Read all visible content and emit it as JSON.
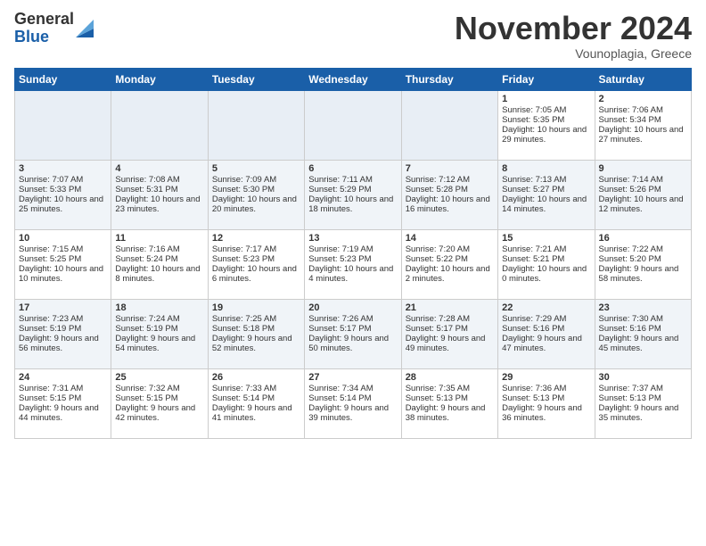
{
  "header": {
    "logo_line1": "General",
    "logo_line2": "Blue",
    "month_title": "November 2024",
    "location": "Vounoplagia, Greece"
  },
  "weekdays": [
    "Sunday",
    "Monday",
    "Tuesday",
    "Wednesday",
    "Thursday",
    "Friday",
    "Saturday"
  ],
  "weeks": [
    [
      {
        "day": "",
        "empty": true
      },
      {
        "day": "",
        "empty": true
      },
      {
        "day": "",
        "empty": true
      },
      {
        "day": "",
        "empty": true
      },
      {
        "day": "",
        "empty": true
      },
      {
        "day": "1",
        "sunrise": "7:05 AM",
        "sunset": "5:35 PM",
        "daylight": "10 hours and 29 minutes."
      },
      {
        "day": "2",
        "sunrise": "7:06 AM",
        "sunset": "5:34 PM",
        "daylight": "10 hours and 27 minutes."
      }
    ],
    [
      {
        "day": "3",
        "sunrise": "7:07 AM",
        "sunset": "5:33 PM",
        "daylight": "10 hours and 25 minutes."
      },
      {
        "day": "4",
        "sunrise": "7:08 AM",
        "sunset": "5:31 PM",
        "daylight": "10 hours and 23 minutes."
      },
      {
        "day": "5",
        "sunrise": "7:09 AM",
        "sunset": "5:30 PM",
        "daylight": "10 hours and 20 minutes."
      },
      {
        "day": "6",
        "sunrise": "7:11 AM",
        "sunset": "5:29 PM",
        "daylight": "10 hours and 18 minutes."
      },
      {
        "day": "7",
        "sunrise": "7:12 AM",
        "sunset": "5:28 PM",
        "daylight": "10 hours and 16 minutes."
      },
      {
        "day": "8",
        "sunrise": "7:13 AM",
        "sunset": "5:27 PM",
        "daylight": "10 hours and 14 minutes."
      },
      {
        "day": "9",
        "sunrise": "7:14 AM",
        "sunset": "5:26 PM",
        "daylight": "10 hours and 12 minutes."
      }
    ],
    [
      {
        "day": "10",
        "sunrise": "7:15 AM",
        "sunset": "5:25 PM",
        "daylight": "10 hours and 10 minutes."
      },
      {
        "day": "11",
        "sunrise": "7:16 AM",
        "sunset": "5:24 PM",
        "daylight": "10 hours and 8 minutes."
      },
      {
        "day": "12",
        "sunrise": "7:17 AM",
        "sunset": "5:23 PM",
        "daylight": "10 hours and 6 minutes."
      },
      {
        "day": "13",
        "sunrise": "7:19 AM",
        "sunset": "5:23 PM",
        "daylight": "10 hours and 4 minutes."
      },
      {
        "day": "14",
        "sunrise": "7:20 AM",
        "sunset": "5:22 PM",
        "daylight": "10 hours and 2 minutes."
      },
      {
        "day": "15",
        "sunrise": "7:21 AM",
        "sunset": "5:21 PM",
        "daylight": "10 hours and 0 minutes."
      },
      {
        "day": "16",
        "sunrise": "7:22 AM",
        "sunset": "5:20 PM",
        "daylight": "9 hours and 58 minutes."
      }
    ],
    [
      {
        "day": "17",
        "sunrise": "7:23 AM",
        "sunset": "5:19 PM",
        "daylight": "9 hours and 56 minutes."
      },
      {
        "day": "18",
        "sunrise": "7:24 AM",
        "sunset": "5:19 PM",
        "daylight": "9 hours and 54 minutes."
      },
      {
        "day": "19",
        "sunrise": "7:25 AM",
        "sunset": "5:18 PM",
        "daylight": "9 hours and 52 minutes."
      },
      {
        "day": "20",
        "sunrise": "7:26 AM",
        "sunset": "5:17 PM",
        "daylight": "9 hours and 50 minutes."
      },
      {
        "day": "21",
        "sunrise": "7:28 AM",
        "sunset": "5:17 PM",
        "daylight": "9 hours and 49 minutes."
      },
      {
        "day": "22",
        "sunrise": "7:29 AM",
        "sunset": "5:16 PM",
        "daylight": "9 hours and 47 minutes."
      },
      {
        "day": "23",
        "sunrise": "7:30 AM",
        "sunset": "5:16 PM",
        "daylight": "9 hours and 45 minutes."
      }
    ],
    [
      {
        "day": "24",
        "sunrise": "7:31 AM",
        "sunset": "5:15 PM",
        "daylight": "9 hours and 44 minutes."
      },
      {
        "day": "25",
        "sunrise": "7:32 AM",
        "sunset": "5:15 PM",
        "daylight": "9 hours and 42 minutes."
      },
      {
        "day": "26",
        "sunrise": "7:33 AM",
        "sunset": "5:14 PM",
        "daylight": "9 hours and 41 minutes."
      },
      {
        "day": "27",
        "sunrise": "7:34 AM",
        "sunset": "5:14 PM",
        "daylight": "9 hours and 39 minutes."
      },
      {
        "day": "28",
        "sunrise": "7:35 AM",
        "sunset": "5:13 PM",
        "daylight": "9 hours and 38 minutes."
      },
      {
        "day": "29",
        "sunrise": "7:36 AM",
        "sunset": "5:13 PM",
        "daylight": "9 hours and 36 minutes."
      },
      {
        "day": "30",
        "sunrise": "7:37 AM",
        "sunset": "5:13 PM",
        "daylight": "9 hours and 35 minutes."
      }
    ]
  ],
  "labels": {
    "sunrise": "Sunrise:",
    "sunset": "Sunset:",
    "daylight": "Daylight:"
  }
}
